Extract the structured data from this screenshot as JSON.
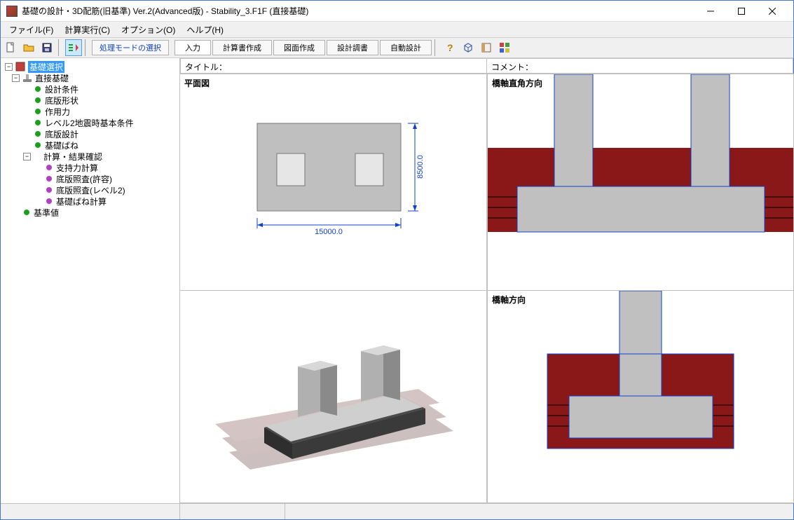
{
  "window": {
    "title": "基礎の設計・3D配筋(旧基準) Ver.2(Advanced版) - Stability_3.F1F (直接基礎)"
  },
  "menu": {
    "file": "ファイル(F)",
    "calc": "計算実行(C)",
    "option": "オプション(O)",
    "help": "ヘルプ(H)"
  },
  "toolbar": {
    "mode_select": "処理モードの選択",
    "input": "入力",
    "calc_report": "計算書作成",
    "drawing": "図面作成",
    "design_report": "設計調書",
    "auto_design": "自動設計"
  },
  "tree": {
    "root": "基礎選択",
    "direct": "直接基礎",
    "cond": "設計条件",
    "shape": "底版形状",
    "force": "作用力",
    "level2": "レベル2地震時基本条件",
    "design": "底版設計",
    "spring": "基礎ばね",
    "results": "計算・結果確認",
    "bearing": "支持力計算",
    "check_allow": "底版照査(許容)",
    "check_l2": "底版照査(レベル2)",
    "spring_calc": "基礎ばね計算",
    "standard": "基準値"
  },
  "headers": {
    "title": "タイトル：",
    "comment": "コメント："
  },
  "panels": {
    "plan": "平面図",
    "perp": "橋軸直角方向",
    "axial": "橋軸方向"
  },
  "dims": {
    "width": "15000.0",
    "depth": "8500.0"
  },
  "colors": {
    "soil": "#8a1818",
    "concrete": "#c0c0c0",
    "dim_line": "#1040d0"
  }
}
